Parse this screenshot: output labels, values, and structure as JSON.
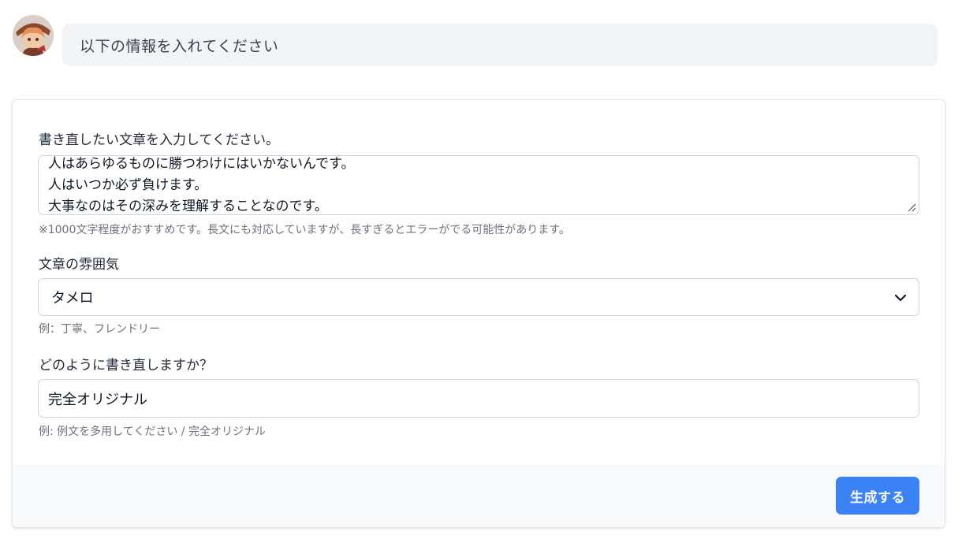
{
  "chat": {
    "message": "以下の情報を入れてください"
  },
  "form": {
    "text_label": "書き直したい文章を入力してください。",
    "text_lines": [
      "人はあらゆるものに勝つわけにはいかないんです。",
      "人はいつか必ず負けます。",
      "大事なのはその深みを理解することなのです。"
    ],
    "text_hint": "※1000文字程度がおすすめです。長文にも対応していますが、長すぎるとエラーがでる可能性があります。",
    "tone_label": "文章の雰囲気",
    "tone_value": "タメロ",
    "tone_hint": "例：丁寧、フレンドリー",
    "style_label": "どのように書き直しますか？",
    "style_value": "完全オリジナル",
    "style_hint": "例: 例文を多用してください / 完全オリジナル",
    "submit_label": "生成する"
  },
  "colors": {
    "accent": "#3b82f6",
    "bubble_bg": "#f3f4f6",
    "footer_bg": "#f9fafb",
    "border": "#d1d5db",
    "hint_text": "#6b7280"
  },
  "icons": {
    "avatar": "anime-avatar-image",
    "select_arrow": "chevron-down-icon",
    "textarea_grip": "resize-grip-icon"
  }
}
